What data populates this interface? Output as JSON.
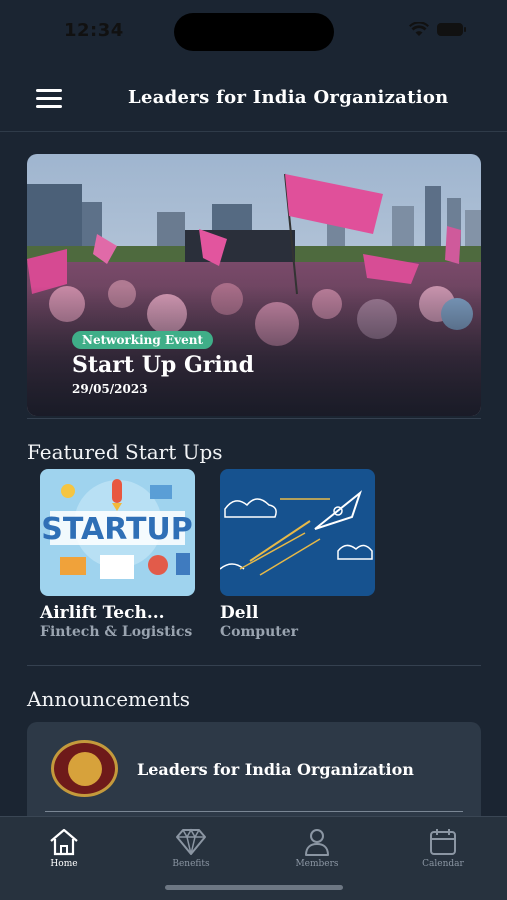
{
  "status_bar": {
    "time": "12:34"
  },
  "header": {
    "title": "Leaders for India Organization"
  },
  "hero": {
    "badge": "Networking Event",
    "title": "Start Up Grind",
    "date": "29/05/2023"
  },
  "featured": {
    "title": "Featured Start Ups",
    "items": [
      {
        "name": "Airlift Tech...",
        "category": "Fintech & Logistics",
        "image_text": "STARTUP"
      },
      {
        "name": "Dell",
        "category": "Computer"
      }
    ]
  },
  "announcements": {
    "title": "Announcements",
    "items": [
      {
        "name": "Leaders for India Organization"
      }
    ]
  },
  "tabbar": {
    "tabs": [
      {
        "label": "Home",
        "icon": "home-icon",
        "active": true
      },
      {
        "label": "Benefits",
        "icon": "diamond-icon",
        "active": false
      },
      {
        "label": "Members",
        "icon": "person-icon",
        "active": false
      },
      {
        "label": "Calendar",
        "icon": "calendar-icon",
        "active": false
      }
    ]
  },
  "colors": {
    "background": "#1b2532",
    "tabbar": "#27323e",
    "card": "#2d3947",
    "badge": "#3fae88"
  }
}
